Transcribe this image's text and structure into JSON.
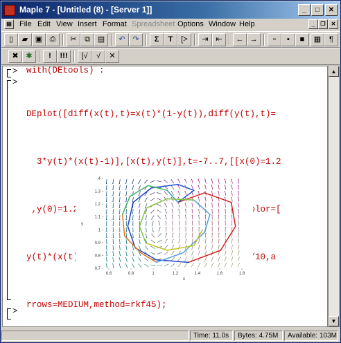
{
  "window": {
    "title": "Maple 7  - [Untitled (8) - [Server 1]]"
  },
  "menu": [
    "File",
    "Edit",
    "View",
    "Insert",
    "Format",
    "Spreadsheet",
    "Options",
    "Window",
    "Help"
  ],
  "worksheet": {
    "prompt": ">",
    "command1": "with(DEtools) :",
    "command2_lines": [
      "DEplot([diff(x(t),t)=x(t)*(1-y(t)),diff(y(t),t)=",
      "  3*y(t)*(x(t)-1)],[x(t),y(t)],t=-7..7,[[x(0)=1.2",
      " ,y(0)=1.2],[x(0)=1,y(0)=.7]],stepsize=.2,color=[",
      "y(t)*(x(t)-1),x(t)*(1-y(t)),.5],linecolor=t/10,a",
      "rrows=MEDIUM,method=rkf45);"
    ]
  },
  "chart_data": {
    "type": "scatter",
    "title": "",
    "xlabel": "x",
    "ylabel": "y",
    "xlim": [
      0.5,
      1.8
    ],
    "ylim": [
      0.65,
      1.4
    ],
    "x_ticks": [
      "0.6",
      "0.8",
      "1",
      "1.2",
      "1.4",
      "1.6",
      "1.8"
    ],
    "y_ticks": [
      ".4",
      "1.3",
      "1.2",
      "1.1",
      "1",
      "0.9",
      "0.8",
      "0.7"
    ],
    "series": [
      {
        "points": [
          [
            1.2,
            1.2
          ],
          [
            1.45,
            1.28
          ],
          [
            1.7,
            1.2
          ],
          [
            1.74,
            1.0
          ],
          [
            1.6,
            0.8
          ],
          [
            1.3,
            0.7
          ],
          [
            1.0,
            0.72
          ],
          [
            0.8,
            0.82
          ],
          [
            0.73,
            1.0
          ],
          [
            0.78,
            1.2
          ],
          [
            0.95,
            1.32
          ],
          [
            1.2,
            1.35
          ],
          [
            1.35,
            1.3
          ],
          [
            1.2,
            1.2
          ]
        ]
      },
      {
        "points": [
          [
            1.0,
            0.7
          ],
          [
            0.85,
            0.78
          ],
          [
            0.7,
            0.92
          ],
          [
            0.68,
            1.1
          ],
          [
            0.75,
            1.25
          ],
          [
            0.92,
            1.34
          ],
          [
            1.1,
            1.3
          ],
          [
            1.2,
            1.2
          ]
        ]
      },
      {
        "points": [
          [
            1.0,
            0.7
          ],
          [
            1.25,
            0.78
          ],
          [
            1.45,
            0.95
          ],
          [
            1.5,
            1.1
          ],
          [
            1.35,
            1.22
          ],
          [
            1.1,
            1.23
          ],
          [
            0.9,
            1.15
          ],
          [
            0.84,
            1.0
          ],
          [
            0.9,
            0.86
          ],
          [
            1.1,
            0.8
          ],
          [
            1.35,
            0.84
          ],
          [
            1.43,
            0.97
          ]
        ]
      }
    ]
  },
  "status": {
    "time": "Time: 11.0s",
    "bytes": "Bytes: 4.75M",
    "available": "Available: 103M"
  },
  "colors": {
    "title_bar": "#0a246a",
    "command": "#c00000",
    "background": "#d4d0c8"
  }
}
